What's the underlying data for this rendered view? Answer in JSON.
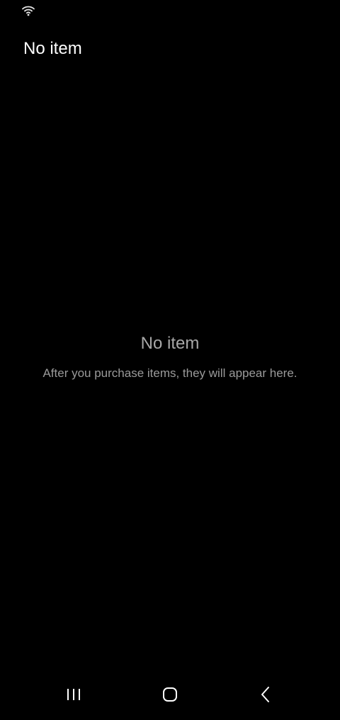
{
  "status_bar": {
    "wifi_icon": "wifi-icon"
  },
  "header": {
    "title": "No item"
  },
  "empty_state": {
    "title": "No item",
    "description": "After you purchase items, they will appear here."
  },
  "nav_bar": {
    "recents_icon": "recents-icon",
    "home_icon": "home-icon",
    "back_icon": "back-icon"
  },
  "colors": {
    "background": "#000000",
    "title_text": "#ffffff",
    "empty_text": "#a8a8a8"
  }
}
